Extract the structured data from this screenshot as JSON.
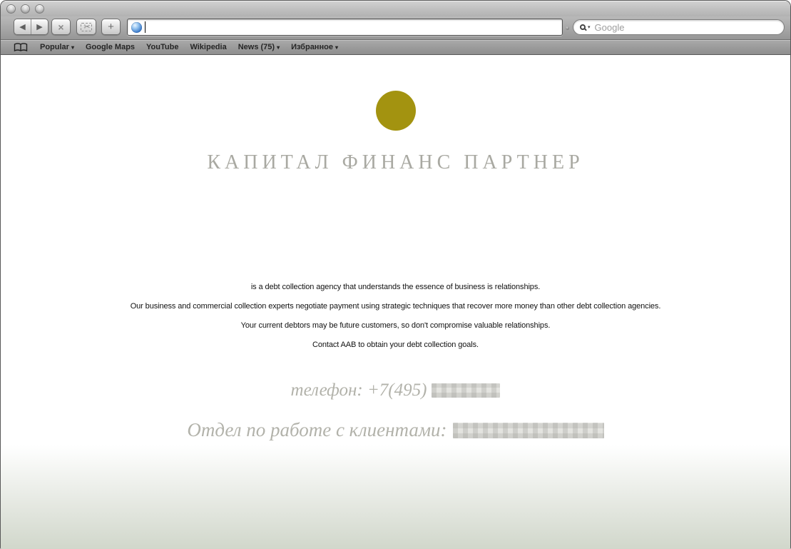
{
  "window": {
    "traffic_lights": [
      "close",
      "minimize",
      "zoom"
    ]
  },
  "toolbar": {
    "icons": {
      "back": "◀",
      "forward": "▶",
      "stop": "×",
      "webclip": "✂",
      "add": "+"
    },
    "address": {
      "value": "",
      "favicon": "globe-icon"
    },
    "search": {
      "placeholder": "Google",
      "dropdown_arrow": "▾"
    }
  },
  "bookmarks_bar": {
    "book_icon": "open-book-icon",
    "items": [
      {
        "label": "Popular",
        "has_dropdown": true
      },
      {
        "label": "Google Maps",
        "has_dropdown": false
      },
      {
        "label": "YouTube",
        "has_dropdown": false
      },
      {
        "label": "Wikipedia",
        "has_dropdown": false
      },
      {
        "label": "News (75)",
        "has_dropdown": true
      },
      {
        "label": "Избранное",
        "has_dropdown": true
      }
    ],
    "dropdown_arrow": "▾"
  },
  "page": {
    "brand": {
      "title": "КАПИТАЛ ФИНАНС ПАРТНЕР",
      "logo_color": "#a39310",
      "title_color": "#a9a9a2"
    },
    "paragraphs": [
      "is a debt collection agency that understands the essence of business is relationships.",
      "Our business and commercial collection experts negotiate payment using strategic techniques that recover more money than other debt collection agencies.",
      "Your current debtors may be future customers, so don't compromise valuable relationships.",
      "Contact AAB to obtain your debt collection goals."
    ],
    "phone": {
      "label": "телефон: +7(495)",
      "value_redacted": true
    },
    "clients": {
      "label": "Отдел по работе с клиентами:",
      "value_redacted": true
    },
    "footer_gradient_color": "#d1d7cb"
  }
}
